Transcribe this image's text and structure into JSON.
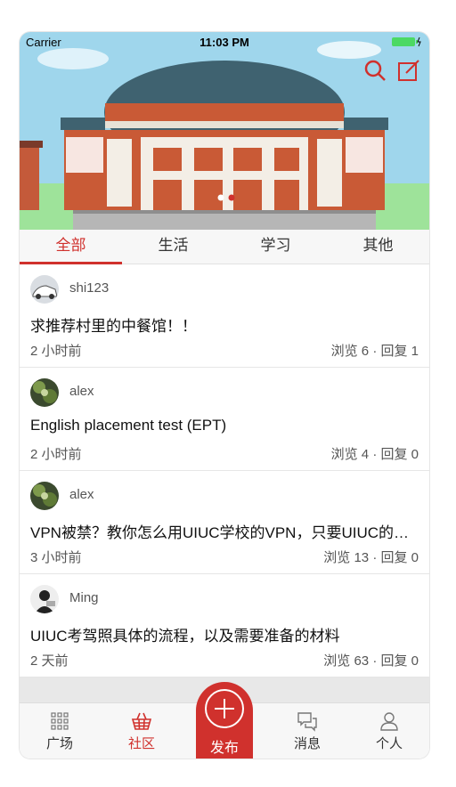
{
  "status_bar": {
    "carrier": "Carrier",
    "time": "11:03 PM"
  },
  "top_actions": {
    "search_icon": "search-icon",
    "compose_icon": "compose-icon",
    "accent": "#d0312d"
  },
  "tabs": [
    {
      "label": "全部",
      "active": true
    },
    {
      "label": "生活",
      "active": false
    },
    {
      "label": "学习",
      "active": false
    },
    {
      "label": "其他",
      "active": false
    }
  ],
  "posts": [
    {
      "username": "shi123",
      "title": "求推荐村里的中餐馆！！",
      "time": "2 小时前",
      "stats": "浏览 6 · 回复 1"
    },
    {
      "username": "alex",
      "title": "English placement test (EPT)",
      "time": "2 小时前",
      "stats": "浏览 4 · 回复 0"
    },
    {
      "username": "alex",
      "title": "VPN被禁？教你怎么用UIUC学校的VPN，只要UIUC的账号",
      "time": "3 小时前",
      "stats": "浏览 13 · 回复 0"
    },
    {
      "username": "Ming",
      "title": "UIUC考驾照具体的流程，以及需要准备的材料",
      "time": "2 天前",
      "stats": "浏览 63 · 回复 0"
    }
  ],
  "bottom_nav": {
    "square": "广场",
    "community": "社区",
    "publish": "发布",
    "messages": "消息",
    "profile": "个人"
  }
}
